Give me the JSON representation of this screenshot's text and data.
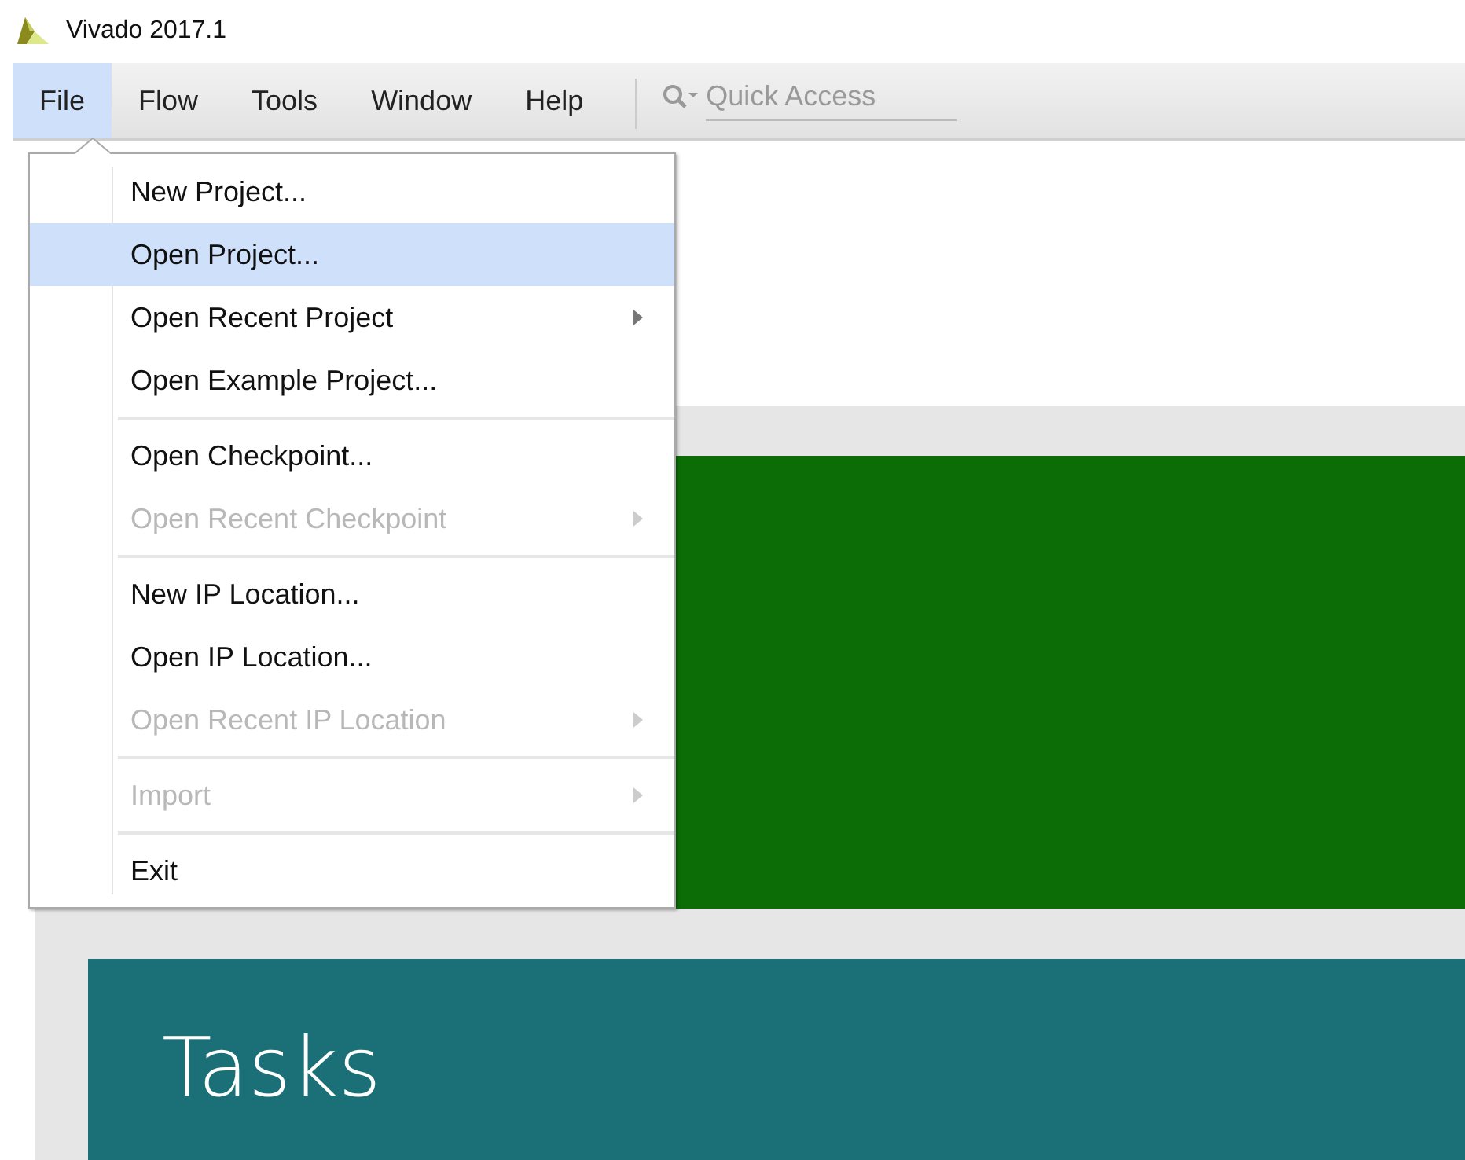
{
  "window": {
    "title": "Vivado 2017.1"
  },
  "menubar": [
    {
      "label": "File",
      "selected": true
    },
    {
      "label": "Flow",
      "selected": false
    },
    {
      "label": "Tools",
      "selected": false
    },
    {
      "label": "Window",
      "selected": false
    },
    {
      "label": "Help",
      "selected": false
    }
  ],
  "quick_access": {
    "placeholder": "Quick Access"
  },
  "file_menu": [
    [
      {
        "label": "New Project...",
        "selected": false,
        "disabled": false,
        "submenu": false
      },
      {
        "label": "Open Project...",
        "selected": true,
        "disabled": false,
        "submenu": false
      },
      {
        "label": "Open Recent Project",
        "selected": false,
        "disabled": false,
        "submenu": true
      },
      {
        "label": "Open Example Project...",
        "selected": false,
        "disabled": false,
        "submenu": false
      }
    ],
    [
      {
        "label": "Open Checkpoint...",
        "selected": false,
        "disabled": false,
        "submenu": false
      },
      {
        "label": "Open Recent Checkpoint",
        "selected": false,
        "disabled": true,
        "submenu": true
      }
    ],
    [
      {
        "label": "New IP Location...",
        "selected": false,
        "disabled": false,
        "submenu": false
      },
      {
        "label": "Open IP Location...",
        "selected": false,
        "disabled": false,
        "submenu": false
      },
      {
        "label": "Open Recent IP Location",
        "selected": false,
        "disabled": true,
        "submenu": true
      }
    ],
    [
      {
        "label": "Import",
        "selected": false,
        "disabled": true,
        "submenu": true
      }
    ],
    [
      {
        "label": "Exit",
        "selected": false,
        "disabled": false,
        "submenu": false
      }
    ]
  ],
  "tasks": {
    "title": "Tasks"
  }
}
